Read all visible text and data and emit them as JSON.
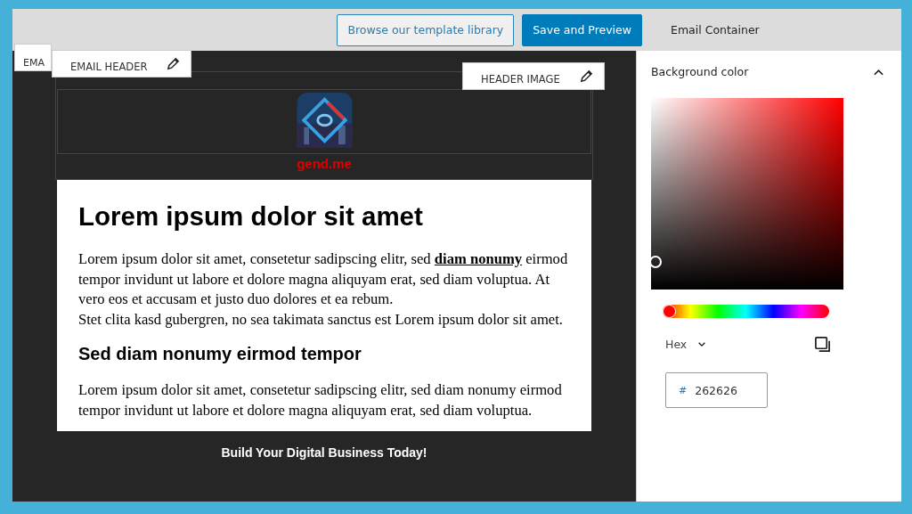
{
  "toolbar": {
    "buttons": [
      {
        "label": "Browse our template library",
        "kind": "outline"
      },
      {
        "label": "Save and Preview",
        "kind": "primary"
      }
    ],
    "panel_title": "Email Container"
  },
  "canvas": {
    "tabs": [
      {
        "label": "EMA",
        "kind": "plain"
      },
      {
        "label": "EMAIL HEADER",
        "kind": "edit"
      },
      {
        "label": "HEADER IMAGE",
        "kind": "edit"
      }
    ],
    "brand": "gend.me",
    "content": {
      "heading": "Lorem ipsum dolor sit amet",
      "paragraph": [
        "Lorem ipsum dolor sit amet, consetetur sadipscing elitr, sed **diam nonumy** eirmod tempor invidunt ut labore et dolore magna aliquyam erat, sed diam voluptua. At vero eos et accusam et justo duo dolores et ea rebum.",
        "Stet clita kasd gubergren, no sea takimata sanctus est Lorem ipsum dolor sit amet."
      ],
      "subheading": "Sed diam nonumy eirmod tempor",
      "paragraph_2": "Lorem ipsum dolor sit amet, consetetur sadipscing elitr, sed diam nonumy eirmod tempor invidunt ut labore et dolore magna aliquyam erat, sed diam voluptua."
    },
    "footer": "Build Your Digital Business Today!"
  },
  "sidebar": {
    "section": {
      "title": "Background color",
      "expanded": true
    },
    "hue": {
      "level": 0
    },
    "format": "Hex",
    "hash": "#",
    "value": "262626"
  }
}
